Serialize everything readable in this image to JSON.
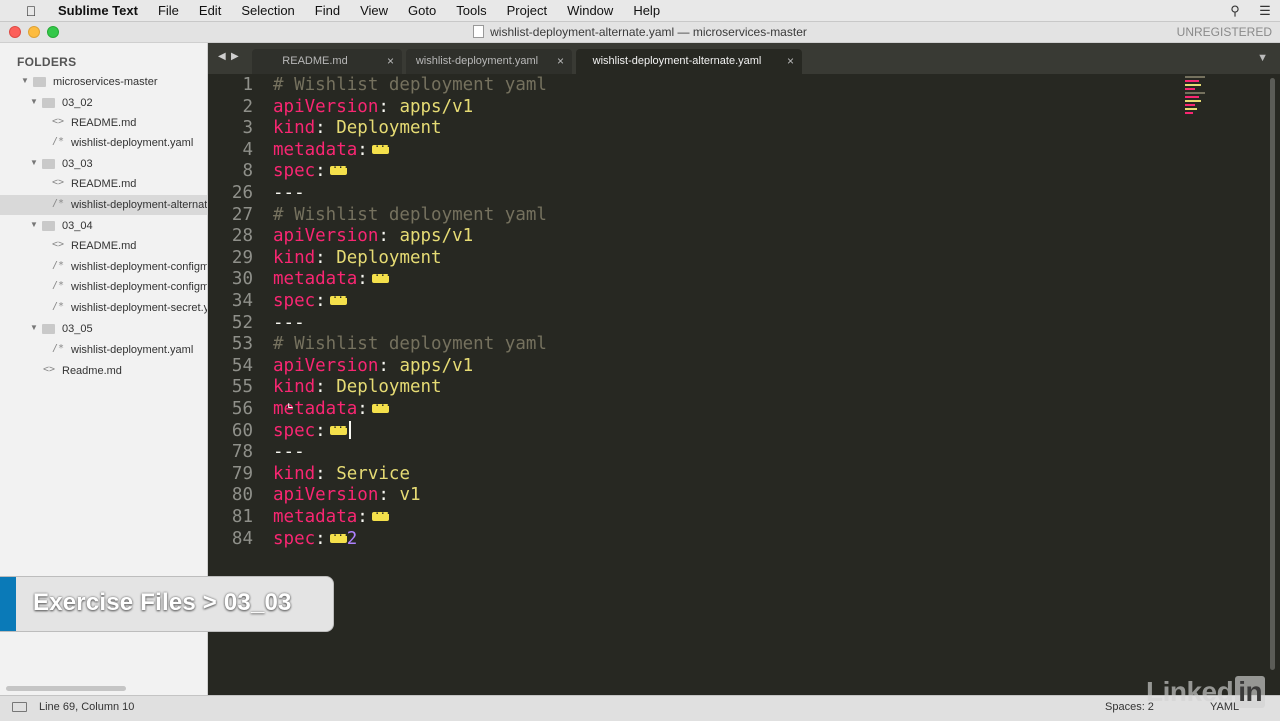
{
  "menubar": {
    "app_name": "Sublime Text",
    "items": [
      "File",
      "Edit",
      "Selection",
      "Find",
      "View",
      "Goto",
      "Tools",
      "Project",
      "Window",
      "Help"
    ]
  },
  "window": {
    "title": "wishlist-deployment-alternate.yaml — microservices-master",
    "unregistered": "UNREGISTERED"
  },
  "sidebar": {
    "header": "FOLDERS",
    "tree": [
      {
        "label": "microservices-master",
        "type": "folder",
        "depth": 0
      },
      {
        "label": "03_02",
        "type": "folder",
        "depth": 1
      },
      {
        "label": "README.md",
        "type": "file",
        "icon": "<>",
        "depth": 2
      },
      {
        "label": "wishlist-deployment.yaml",
        "type": "file",
        "icon": "/*",
        "depth": 2
      },
      {
        "label": "03_03",
        "type": "folder",
        "depth": 1
      },
      {
        "label": "README.md",
        "type": "file",
        "icon": "<>",
        "depth": 2
      },
      {
        "label": "wishlist-deployment-alternate.yaml",
        "type": "file",
        "icon": "/*",
        "depth": 2,
        "selected": true
      },
      {
        "label": "03_04",
        "type": "folder",
        "depth": 1
      },
      {
        "label": "README.md",
        "type": "file",
        "icon": "<>",
        "depth": 2
      },
      {
        "label": "wishlist-deployment-configmap.yaml",
        "type": "file",
        "icon": "/*",
        "depth": 2
      },
      {
        "label": "wishlist-deployment-configmap-env.yaml",
        "type": "file",
        "icon": "/*",
        "depth": 2
      },
      {
        "label": "wishlist-deployment-secret.yaml",
        "type": "file",
        "icon": "/*",
        "depth": 2
      },
      {
        "label": "03_05",
        "type": "folder",
        "depth": 1
      },
      {
        "label": "wishlist-deployment.yaml",
        "type": "file",
        "icon": "/*",
        "depth": 2
      },
      {
        "label": "Readme.md",
        "type": "file",
        "icon": "<>",
        "depth": 1
      }
    ]
  },
  "tabs": [
    {
      "label": "README.md",
      "active": false
    },
    {
      "label": "wishlist-deployment.yaml",
      "active": false
    },
    {
      "label": "wishlist-deployment-alternate.yaml",
      "active": true
    }
  ],
  "editor": {
    "lines": [
      {
        "num": "1",
        "parts": [
          [
            "comment",
            "# Wishlist deployment yaml"
          ]
        ]
      },
      {
        "num": "2",
        "parts": [
          [
            "key",
            "apiVersion"
          ],
          [
            "punc",
            ": "
          ],
          [
            "val",
            "apps/v1"
          ]
        ]
      },
      {
        "num": "3",
        "parts": [
          [
            "key",
            "kind"
          ],
          [
            "punc",
            ": "
          ],
          [
            "val",
            "Deployment"
          ]
        ]
      },
      {
        "num": "4",
        "parts": [
          [
            "key",
            "metadata"
          ],
          [
            "punc",
            ":"
          ],
          [
            "fold",
            ""
          ]
        ]
      },
      {
        "num": "8",
        "parts": [
          [
            "key",
            "spec"
          ],
          [
            "punc",
            ":"
          ],
          [
            "fold",
            ""
          ]
        ]
      },
      {
        "num": "26",
        "parts": [
          [
            "punc",
            "---"
          ]
        ]
      },
      {
        "num": "27",
        "parts": [
          [
            "comment",
            "# Wishlist deployment yaml"
          ]
        ]
      },
      {
        "num": "28",
        "parts": [
          [
            "key",
            "apiVersion"
          ],
          [
            "punc",
            ": "
          ],
          [
            "val",
            "apps/v1"
          ]
        ]
      },
      {
        "num": "29",
        "parts": [
          [
            "key",
            "kind"
          ],
          [
            "punc",
            ": "
          ],
          [
            "val",
            "Deployment"
          ]
        ]
      },
      {
        "num": "30",
        "parts": [
          [
            "key",
            "metadata"
          ],
          [
            "punc",
            ":"
          ],
          [
            "fold",
            ""
          ]
        ]
      },
      {
        "num": "34",
        "parts": [
          [
            "key",
            "spec"
          ],
          [
            "punc",
            ":"
          ],
          [
            "fold",
            ""
          ]
        ]
      },
      {
        "num": "52",
        "parts": [
          [
            "punc",
            "---"
          ]
        ]
      },
      {
        "num": "53",
        "parts": [
          [
            "comment",
            "# Wishlist deployment yaml"
          ]
        ]
      },
      {
        "num": "54",
        "parts": [
          [
            "key",
            "apiVersion"
          ],
          [
            "punc",
            ": "
          ],
          [
            "val",
            "apps/v1"
          ]
        ]
      },
      {
        "num": "55",
        "parts": [
          [
            "key",
            "kind"
          ],
          [
            "punc",
            ": "
          ],
          [
            "val",
            "Deployment"
          ]
        ]
      },
      {
        "num": "56",
        "parts": [
          [
            "key",
            "metadata"
          ],
          [
            "punc",
            ":"
          ],
          [
            "fold",
            ""
          ]
        ]
      },
      {
        "num": "60",
        "parts": [
          [
            "key",
            "spec"
          ],
          [
            "punc",
            ":"
          ],
          [
            "fold",
            ""
          ],
          [
            "caret",
            ""
          ]
        ]
      },
      {
        "num": "78",
        "parts": [
          [
            "punc",
            "---"
          ]
        ]
      },
      {
        "num": "79",
        "parts": [
          [
            "key",
            "kind"
          ],
          [
            "punc",
            ": "
          ],
          [
            "val",
            "Service"
          ]
        ]
      },
      {
        "num": "80",
        "parts": [
          [
            "key",
            "apiVersion"
          ],
          [
            "punc",
            ": "
          ],
          [
            "val",
            "v1"
          ]
        ]
      },
      {
        "num": "81",
        "parts": [
          [
            "key",
            "metadata"
          ],
          [
            "punc",
            ":"
          ],
          [
            "fold",
            ""
          ]
        ]
      },
      {
        "num": "84",
        "parts": [
          [
            "key",
            "spec"
          ],
          [
            "punc",
            ":"
          ],
          [
            "fold",
            ""
          ],
          [
            "num",
            "2"
          ]
        ]
      }
    ]
  },
  "status": {
    "position": "Line 69, Column 10",
    "spaces": "Spaces: 2",
    "syntax": "YAML"
  },
  "overlay": {
    "caption": "Exercise Files > 03_03"
  },
  "watermark": {
    "text": "Linked",
    "badge": "in"
  },
  "colors": {
    "editor_bg": "#272822",
    "key": "#f92672",
    "value": "#e6db74",
    "comment": "#75715e",
    "number": "#ae81ff",
    "fold_marker": "#f4e04b",
    "banner_stripe": "#0a7ab8"
  }
}
